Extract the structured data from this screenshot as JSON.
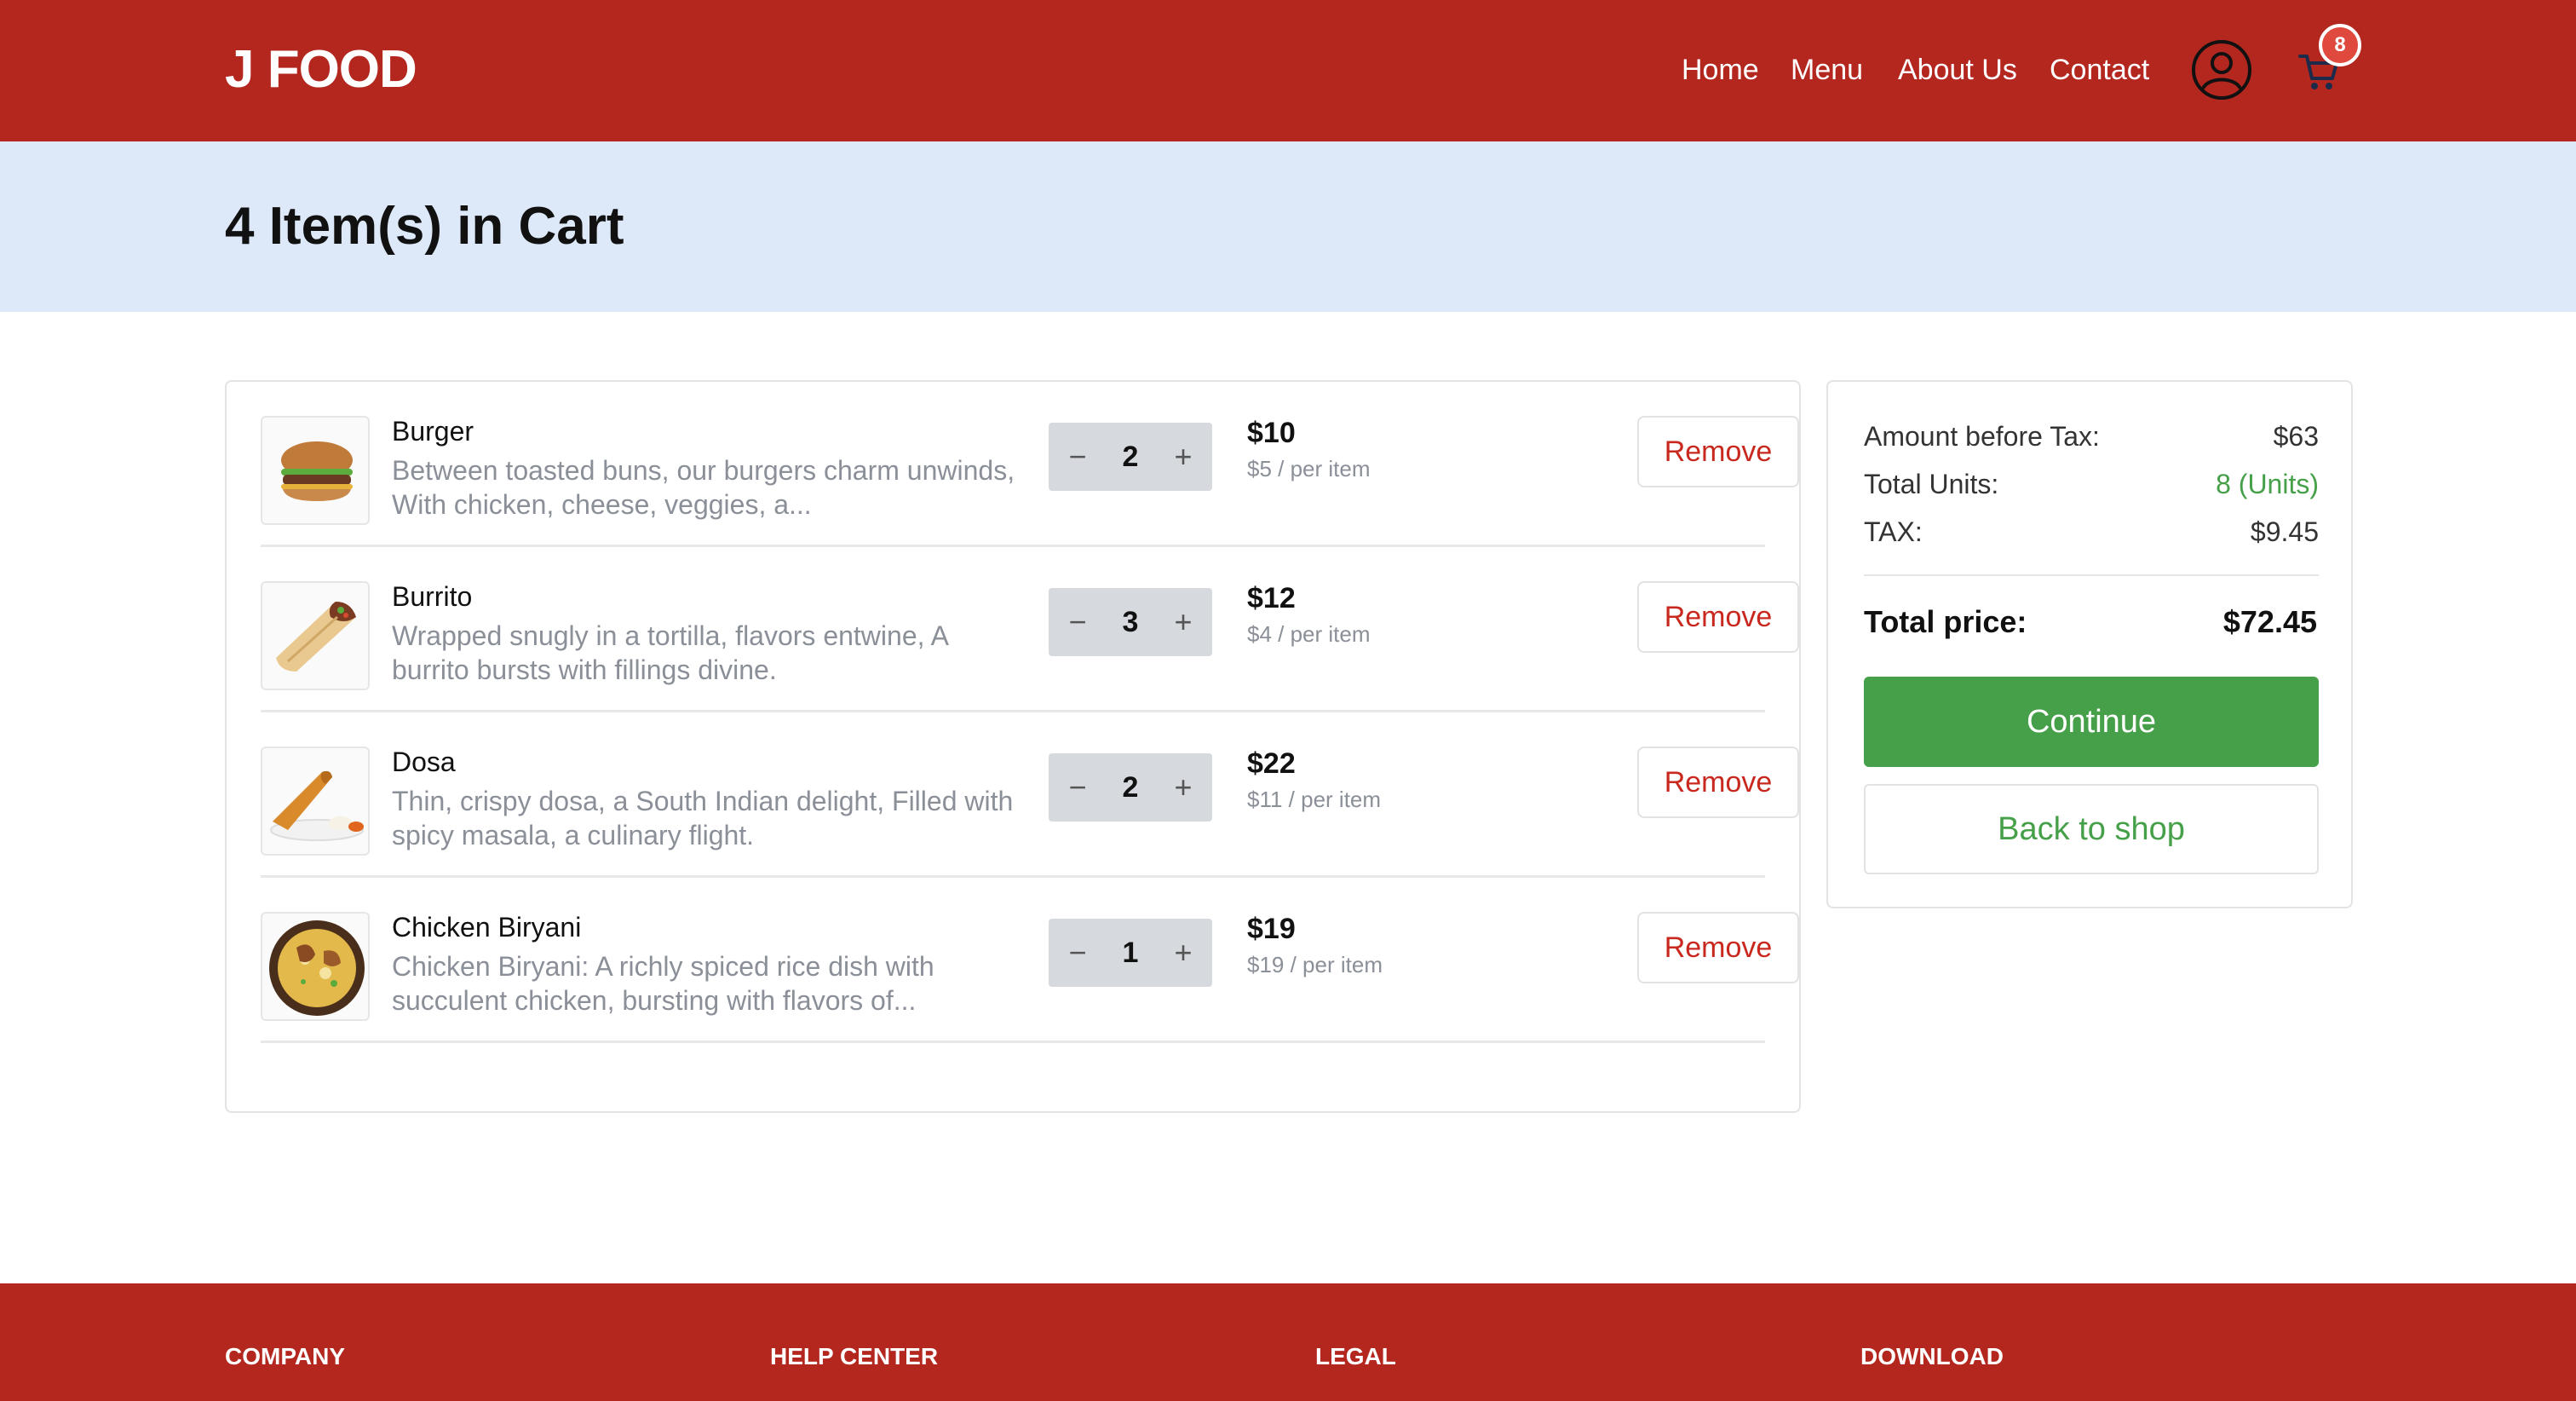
{
  "brand": {
    "name": "J FOOD"
  },
  "nav": {
    "links": [
      {
        "label": "Home"
      },
      {
        "label": "Menu"
      },
      {
        "label": "About Us"
      },
      {
        "label": "Contact"
      }
    ],
    "user_icon": "user-circle-icon",
    "cart_icon": "shopping-cart-icon",
    "cart_count": "8"
  },
  "hero": {
    "title": "4 Item(s) in Cart"
  },
  "cart": {
    "items": [
      {
        "name": "Burger",
        "description": "Between toasted buns, our burgers charm unwinds, With chicken, cheese, veggies, a...",
        "quantity": "2",
        "price": "$10",
        "per_item": "$5 / per item",
        "remove_label": "Remove",
        "image_icon": "burger-image"
      },
      {
        "name": "Burrito",
        "description": "Wrapped snugly in a tortilla, flavors entwine, A burrito bursts with fillings divine.",
        "quantity": "3",
        "price": "$12",
        "per_item": "$4 / per item",
        "remove_label": "Remove",
        "image_icon": "burrito-image"
      },
      {
        "name": "Dosa",
        "description": "Thin, crispy dosa, a South Indian delight, Filled with spicy masala, a culinary flight.",
        "quantity": "2",
        "price": "$22",
        "per_item": "$11 / per item",
        "remove_label": "Remove",
        "image_icon": "dosa-image"
      },
      {
        "name": "Chicken Biryani",
        "description": "Chicken Biryani: A richly spiced rice dish with succulent chicken, bursting with flavors of...",
        "quantity": "1",
        "price": "$19",
        "per_item": "$19 / per item",
        "remove_label": "Remove",
        "image_icon": "biryani-image"
      }
    ],
    "minus_symbol": "−",
    "plus_symbol": "+"
  },
  "summary": {
    "amount_before_tax_label": "Amount before Tax:",
    "amount_before_tax": "$63",
    "total_units_label": "Total Units:",
    "total_units": "8 (Units)",
    "tax_label": "TAX:",
    "tax": "$9.45",
    "total_label": "Total price:",
    "total": "$72.45",
    "continue_label": "Continue",
    "back_label": "Back to shop"
  },
  "footer": {
    "columns": [
      {
        "label": "COMPANY"
      },
      {
        "label": "HELP CENTER"
      },
      {
        "label": "LEGAL"
      },
      {
        "label": "DOWNLOAD"
      }
    ]
  },
  "colors": {
    "brand_red": "#b3271f",
    "hero_bg": "#dde8f8",
    "accent_green": "#46a049",
    "remove_red": "#c8281d"
  }
}
